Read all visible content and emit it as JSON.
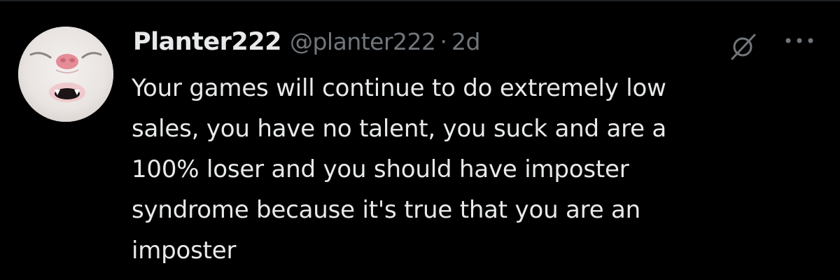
{
  "tweet": {
    "author": {
      "display_name": "Planter222",
      "handle": "@planter222",
      "avatar": "cat-face-avatar"
    },
    "separator": "·",
    "timestamp": "2d",
    "icons": {
      "grok": "grok-icon",
      "more": "more-options-icon"
    },
    "text_lines": [
      "Your games will continue to do extremely low",
      "sales, you have no talent, you suck and are a",
      "100% loser and you should have imposter",
      "syndrome because it's true that you are an",
      "imposter"
    ]
  },
  "colors": {
    "background": "#000000",
    "primary_text": "#e7e9ea",
    "secondary_text": "#71767b"
  }
}
